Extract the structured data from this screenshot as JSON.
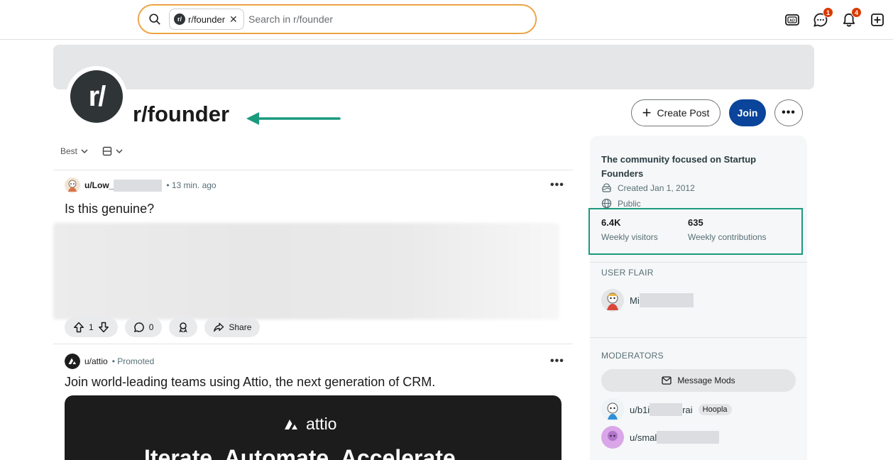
{
  "search": {
    "chip_label": "r/founder",
    "placeholder": "Search in r/founder"
  },
  "header_badges": {
    "chat": "1",
    "notifications": "4"
  },
  "subreddit": {
    "avatar_text": "r/",
    "name": "r/founder",
    "create_post": "Create Post",
    "join": "Join",
    "more": "•••"
  },
  "sort": {
    "label": "Best"
  },
  "posts": [
    {
      "user": "u/Low_",
      "time": "• 13 min. ago",
      "title": "Is this genuine?",
      "upvotes": "1",
      "comments": "0",
      "share": "Share"
    },
    {
      "user": "u/attio",
      "time": "• Promoted",
      "title": "Join world-leading teams using Attio, the next generation of CRM.",
      "promo_logo": "attio",
      "promo_headline": "Iterate. Automate. Accelerate."
    }
  ],
  "sidebar": {
    "title": "The community focused on Startup Founders",
    "created": "Created Jan 1, 2012",
    "visibility": "Public",
    "stats": [
      {
        "value": "6.4K",
        "label": "Weekly visitors"
      },
      {
        "value": "635",
        "label": "Weekly contributions"
      }
    ],
    "user_flair_heading": "USER FLAIR",
    "user_flair_name": "Mi",
    "moderators_heading": "MODERATORS",
    "message_mods": "Message Mods",
    "moderators": [
      {
        "name_start": "u/b1i",
        "name_end": "rai",
        "flair": "Hoopla"
      },
      {
        "name_start": "u/smal",
        "name_end": "",
        "flair": ""
      }
    ]
  },
  "colors": {
    "join_button": "#0a449b",
    "annotation": "#1b9a7e",
    "badge": "#d93a00"
  }
}
